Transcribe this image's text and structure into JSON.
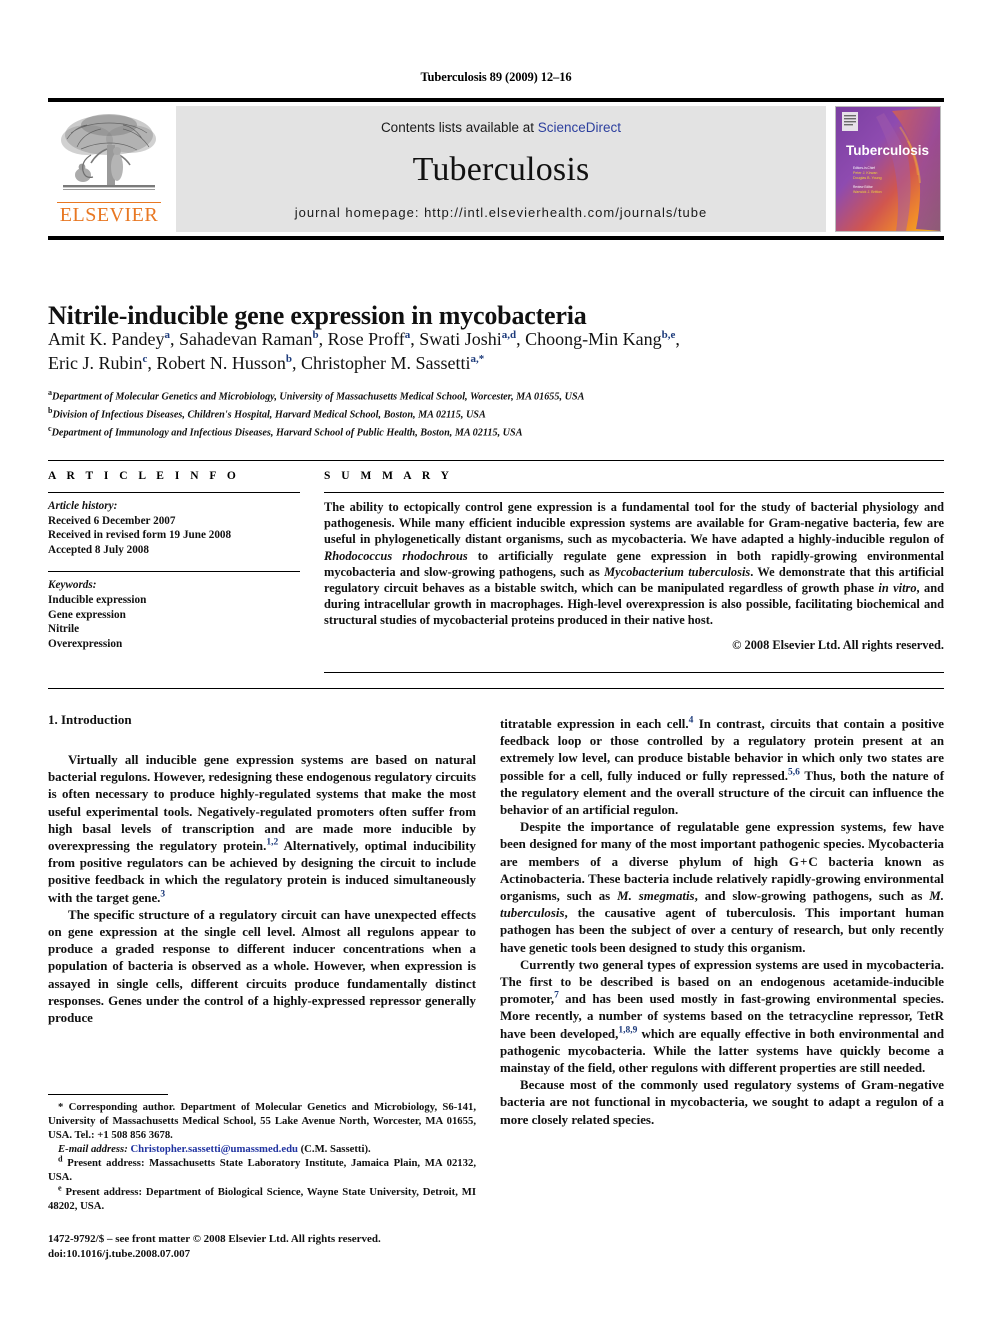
{
  "running_head": "Tuberculosis 89 (2009) 12–16",
  "masthead": {
    "publisher_name": "ELSEVIER",
    "contents_prefix": "Contents lists available at ",
    "contents_link": "ScienceDirect",
    "journal_name": "Tuberculosis",
    "homepage_label": "journal homepage: ",
    "homepage_url": "http://intl.elsevierhealth.com/journals/tube",
    "cover_title": "Tuberculosis",
    "cover_editors_1": "Editors-in-Chief",
    "cover_editors_2": "Peter J. Kirwan",
    "cover_editors_3": "Douglas B. Young",
    "cover_editors_4": "Review Editor",
    "cover_editors_5": "Warwick J. Britton"
  },
  "article": {
    "title": "Nitrile-inducible gene expression in mycobacteria",
    "authors_line_1": "Amit K. Pandey a, Sahadevan Raman b, Rose Proff a, Swati Joshi a,d, Choong-Min Kang b,e,",
    "authors_line_2": "Eric J. Rubin c, Robert N. Husson b, Christopher M. Sassetti a,*",
    "authors": [
      {
        "name": "Amit K. Pandey",
        "sup": "a",
        "sep": ", "
      },
      {
        "name": "Sahadevan Raman",
        "sup": "b",
        "sep": ", "
      },
      {
        "name": "Rose Proff",
        "sup": "a",
        "sep": ", "
      },
      {
        "name": "Swati Joshi",
        "sup": "a,d",
        "sep": ", "
      },
      {
        "name": "Choong-Min Kang",
        "sup": "b,e",
        "sep": ","
      },
      {
        "name": "Eric J. Rubin",
        "sup": "c",
        "sep": ", "
      },
      {
        "name": "Robert N. Husson",
        "sup": "b",
        "sep": ", "
      },
      {
        "name": "Christopher M. Sassetti",
        "sup": "a,*",
        "sep": ""
      }
    ],
    "affiliations": [
      {
        "mark": "a",
        "text": "Department of Molecular Genetics and Microbiology, University of Massachusetts Medical School, Worcester, MA 01655, USA"
      },
      {
        "mark": "b",
        "text": "Division of Infectious Diseases, Children's Hospital, Harvard Medical School, Boston, MA 02115, USA"
      },
      {
        "mark": "c",
        "text": "Department of Immunology and Infectious Diseases, Harvard School of Public Health, Boston, MA 02115, USA"
      }
    ]
  },
  "article_info": {
    "heading": "A R T I C L E  I N F O",
    "history_label": "Article history:",
    "history": [
      "Received 6 December 2007",
      "Received in revised form 19 June 2008",
      "Accepted 8 July 2008"
    ],
    "keywords_label": "Keywords:",
    "keywords": [
      "Inducible expression",
      "Gene expression",
      "Nitrile",
      "Overexpression"
    ]
  },
  "summary": {
    "heading": "S U M M A R Y",
    "body_html": "The ability to ectopically control gene expression is a fundamental tool for the study of bacterial physiology and pathogenesis. While many efficient inducible expression systems are available for Gram-negative bacteria, few are useful in phylogenetically distant organisms, such as mycobacteria. We have adapted a highly-inducible regulon of <i>Rhodococcus rhodochrous</i> to artificially regulate gene expression in both rapidly-growing environmental mycobacteria and slow-growing pathogens, such as <i>Mycobacterium tuberculosis</i>. We demonstrate that this artificial regulatory circuit behaves as a bistable switch, which can be manipulated regardless of growth phase <i>in vitro</i>, and during intracellular growth in macrophages. High-level overexpression is also possible, facilitating biochemical and structural studies of mycobacterial proteins produced in their native host.",
    "copyright": "© 2008 Elsevier Ltd. All rights reserved."
  },
  "body": {
    "section_heading": "1. Introduction",
    "left_paragraphs": [
      "Virtually all inducible gene expression systems are based on natural bacterial regulons. However, redesigning these endogenous regulatory circuits is often necessary to produce highly-regulated systems that make the most useful experimental tools. Negatively-regulated promoters often suffer from high basal levels of transcription and are made more inducible by overexpressing the regulatory protein.<sup>1,2</sup> Alternatively, optimal inducibility from positive regulators can be achieved by designing the circuit to include positive feedback in which the regulatory protein is induced simultaneously with the target gene.<sup>3</sup>",
      "The specific structure of a regulatory circuit can have unexpected effects on gene expression at the single cell level. Almost all regulons appear to produce a graded response to different inducer concentrations when a population of bacteria is observed as a whole. However, when expression is assayed in single cells, different circuits produce fundamentally distinct responses. Genes under the control of a highly-expressed repressor generally produce"
    ],
    "right_paragraphs": [
      "titratable expression in each cell.<sup>4</sup> In contrast, circuits that contain a positive feedback loop or those controlled by a regulatory protein present at an extremely low level, can produce bistable behavior in which only two states are possible for a cell, fully induced or fully repressed.<sup>5,6</sup> Thus, both the nature of the regulatory element and the overall structure of the circuit can influence the behavior of an artificial regulon.",
      "Despite the importance of regulatable gene expression systems, few have been designed for many of the most important pathogenic species. Mycobacteria are members of a diverse phylum of high G&#8202;+&#8202;C bacteria known as Actinobacteria. These bacteria include relatively rapidly-growing environmental organisms, such as <i>M. smegmatis</i>, and slow-growing pathogens, such as <i>M. tuberculosis</i>, the causative agent of tuberculosis. This important human pathogen has been the subject of over a century of research, but only recently have genetic tools been designed to study this organism.",
      "Currently two general types of expression systems are used in mycobacteria. The first to be described is based on an endogenous acetamide-inducible promoter,<sup>7</sup> and has been used mostly in fast-growing environmental species. More recently, a number of systems based on the tetracycline repressor, TetR have been developed,<sup>1,8,9</sup> which are equally effective in both environmental and pathogenic mycobacteria. While the latter systems have quickly become a mainstay of the field, other regulons with different properties are still needed.",
      "Because most of the commonly used regulatory systems of Gram-negative bacteria are not functional in mycobacteria, we sought to adapt a regulon of a more closely related species."
    ]
  },
  "footnotes": {
    "corresponding": "* Corresponding author. Department of Molecular Genetics and Microbiology, S6-141, University of Massachusetts Medical School, 55 Lake Avenue North, Worcester, MA 01655, USA. Tel.: +1 508 856 3678.",
    "email_label": "E-mail address:",
    "email": "Christopher.sassetti@umassmed.edu",
    "email_owner": "(C.M. Sassetti).",
    "present_address_d_mark": "d",
    "present_address_d": "Present address: Massachusetts State Laboratory Institute, Jamaica Plain, MA 02132, USA.",
    "present_address_e_mark": "e",
    "present_address_e": "Present address: Department of Biological Science, Wayne State University, Detroit, MI 48202, USA."
  },
  "imprint": {
    "line1": "1472-9792/$ – see front matter © 2008 Elsevier Ltd. All rights reserved.",
    "line2": "doi:10.1016/j.tube.2008.07.007"
  },
  "colors": {
    "elsevier_orange": "#E87722",
    "sciencedirect_blue": "#2c3f9e",
    "link_blue": "#2033a0",
    "superscript_blue": "#1c3a7a",
    "band_gray": "#e3e3e3"
  }
}
